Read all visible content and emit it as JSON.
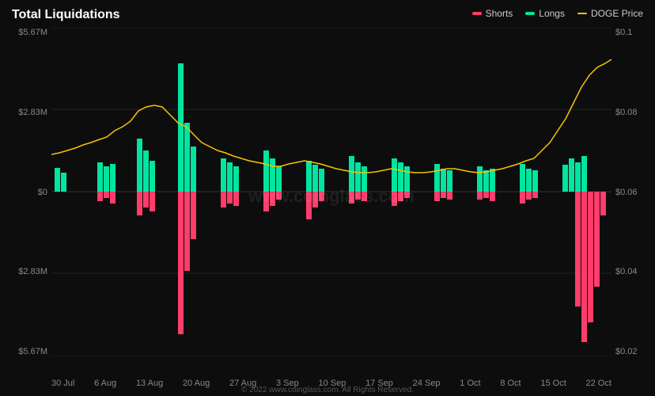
{
  "title": "Total Liquidations",
  "legend": {
    "shorts": {
      "label": "Shorts",
      "color": "#ff3d6b"
    },
    "longs": {
      "label": "Longs",
      "color": "#00e5a0"
    },
    "doge": {
      "label": "DOGE Price",
      "color": "#f5c500"
    }
  },
  "yAxisLeft": [
    "$5.67M",
    "$2.83M",
    "$0",
    "$2.83M",
    "$5.67M"
  ],
  "yAxisRight": [
    "$0.1",
    "$0.08",
    "$0.06",
    "$0.04",
    "$0.02"
  ],
  "xAxisLabels": [
    "30 Jul",
    "6 Aug",
    "13 Aug",
    "20 Aug",
    "27 Aug",
    "3 Sep",
    "10 Sep",
    "17 Sep",
    "24 Sep",
    "1 Oct",
    "8 Oct",
    "15 Oct",
    "22 Oct"
  ],
  "footer": "© 2022 www.coinglass.com. All Rights Reserved."
}
